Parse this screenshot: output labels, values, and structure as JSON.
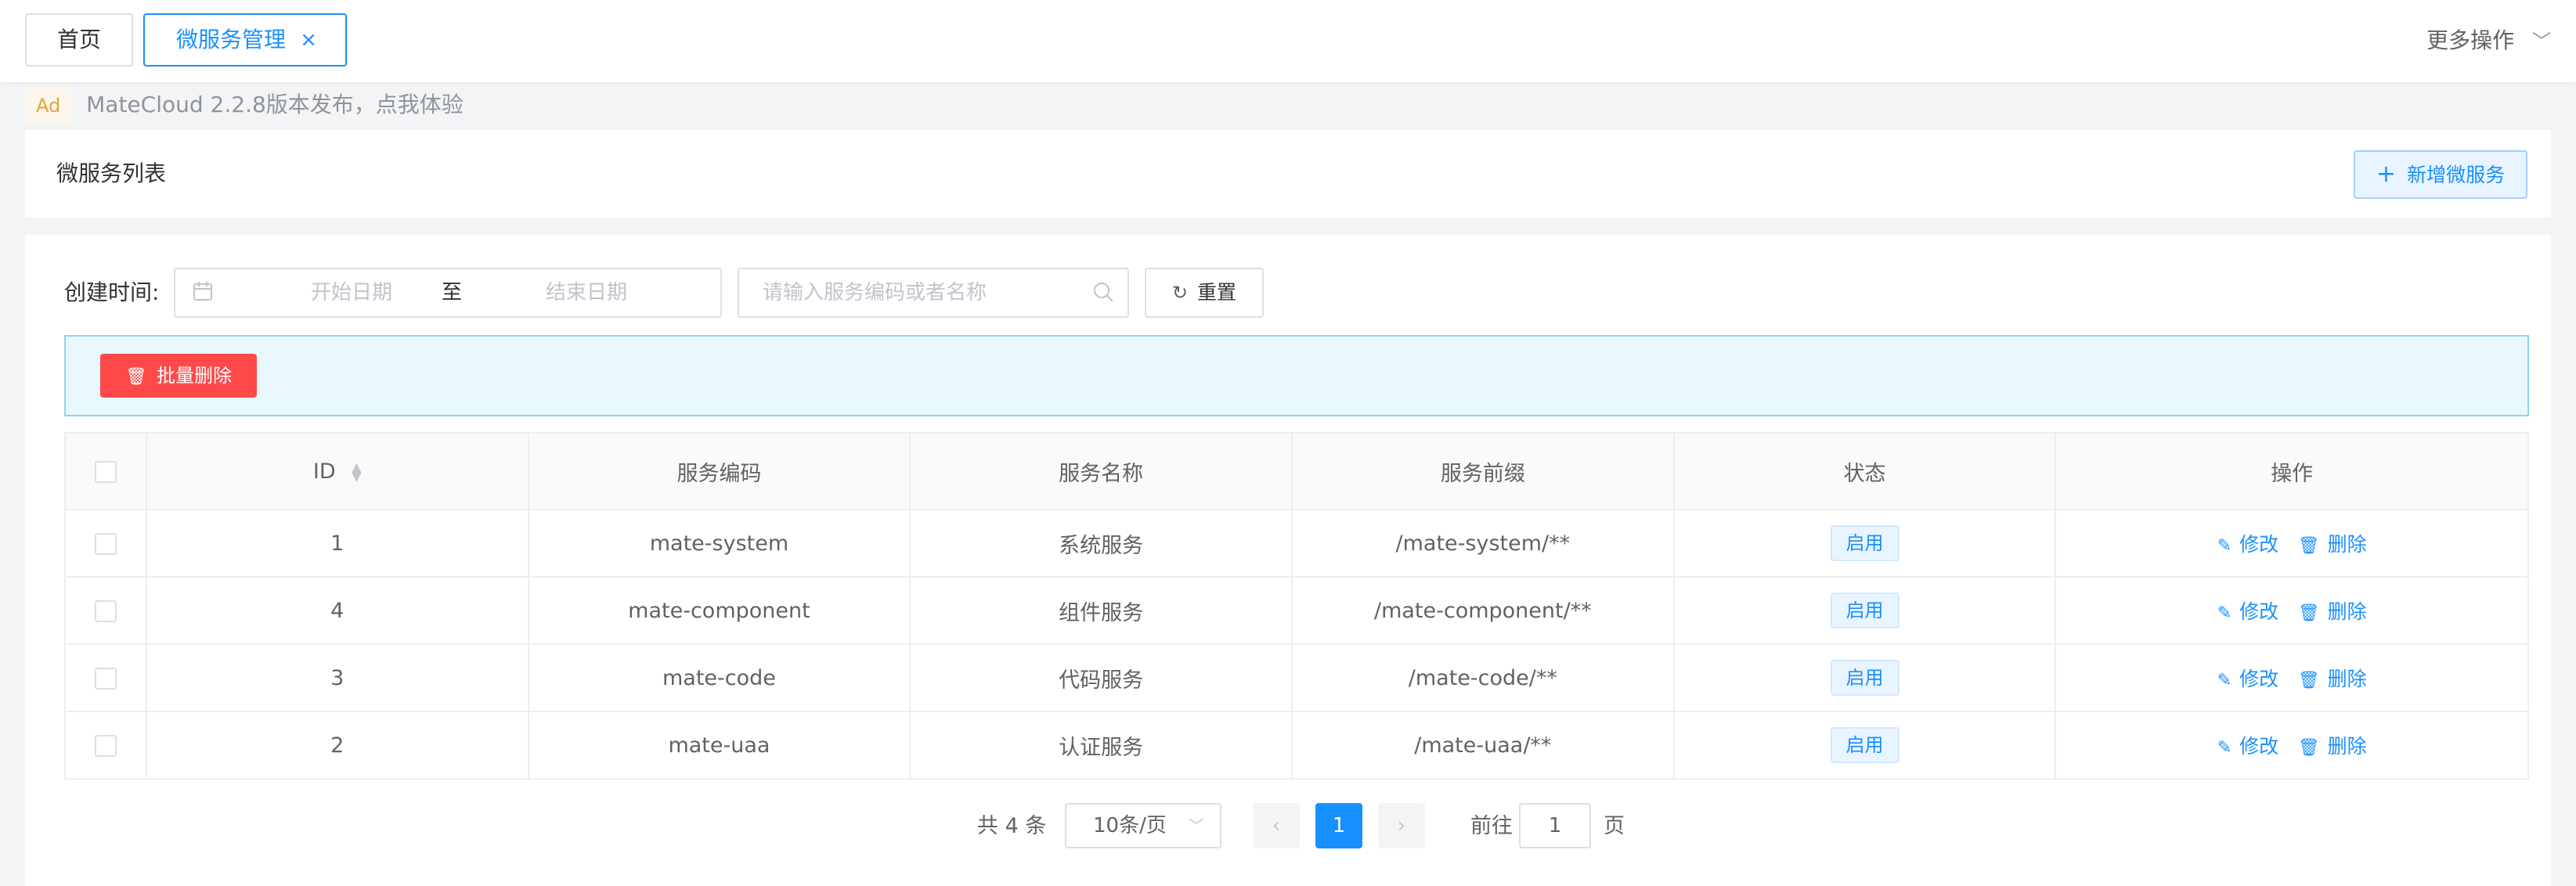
{
  "tabs": {
    "home": "首页",
    "active": "微服务管理",
    "close_glyph": "×",
    "more_ops": "更多操作"
  },
  "ad": {
    "badge": "Ad",
    "text": "MateCloud 2.2.8版本发布，点我体验"
  },
  "header": {
    "title": "微服务列表",
    "add_button": "新增微服务"
  },
  "filters": {
    "created_label": "创建时间:",
    "start_placeholder": "开始日期",
    "range_sep": "至",
    "end_placeholder": "结束日期",
    "search_placeholder": "请输入服务编码或者名称",
    "reset_button": "重置"
  },
  "batch": {
    "delete_button": "批量删除"
  },
  "table": {
    "columns": [
      "ID",
      "服务编码",
      "服务名称",
      "服务前缀",
      "状态",
      "操作"
    ],
    "rows": [
      {
        "id": "1",
        "code": "mate-system",
        "name": "系统服务",
        "prefix": "/mate-system/**",
        "status": "启用"
      },
      {
        "id": "4",
        "code": "mate-component",
        "name": "组件服务",
        "prefix": "/mate-component/**",
        "status": "启用"
      },
      {
        "id": "3",
        "code": "mate-code",
        "name": "代码服务",
        "prefix": "/mate-code/**",
        "status": "启用"
      },
      {
        "id": "2",
        "code": "mate-uaa",
        "name": "认证服务",
        "prefix": "/mate-uaa/**",
        "status": "启用"
      }
    ],
    "edit_label": "修改",
    "delete_label": "删除"
  },
  "pagination": {
    "total": "共 4 条",
    "page_size": "10条/页",
    "current_page": "1",
    "goto_label": "前往",
    "goto_value": "1",
    "page_unit": "页"
  },
  "colors": {
    "primary": "#1890ff",
    "danger": "#ff4949",
    "info_bg": "#e8f8fd"
  }
}
